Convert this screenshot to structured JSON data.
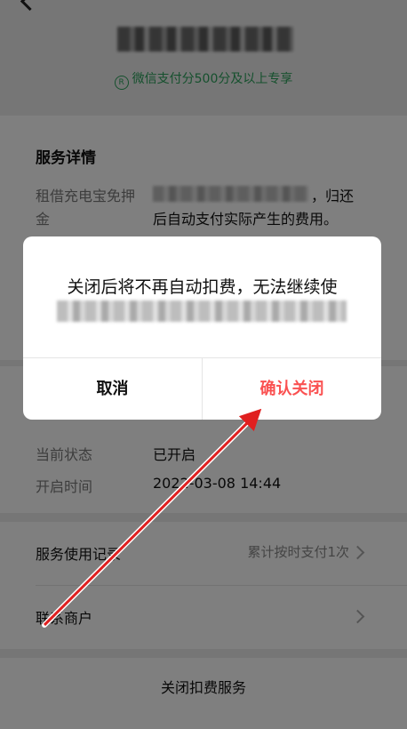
{
  "header": {
    "badge_text": "微信支付分500分及以上专享"
  },
  "details": {
    "section_title": "服务详情",
    "label": "租借充电宝免押金",
    "value_line1": "，归还",
    "value_line2": "后自动支付实际产生的费用。"
  },
  "status": {
    "current_status_label": "当前状态",
    "current_status_value": "已开启",
    "open_time_label": "开启时间",
    "open_time_value": "2022-03-08 14:44"
  },
  "list": {
    "usage_record_label": "服务使用记录",
    "usage_record_value": "累计按时支付1次",
    "contact_merchant_label": "联系商户"
  },
  "footer": {
    "close_service_label": "关闭扣费服务"
  },
  "dialog": {
    "message": "关闭后将不再自动扣费，无法继续使",
    "cancel_label": "取消",
    "confirm_label": "确认关闭"
  },
  "colors": {
    "accent_green": "#2aa05a",
    "danger_red": "#fa5151",
    "annotation_arrow": "#e02020"
  }
}
